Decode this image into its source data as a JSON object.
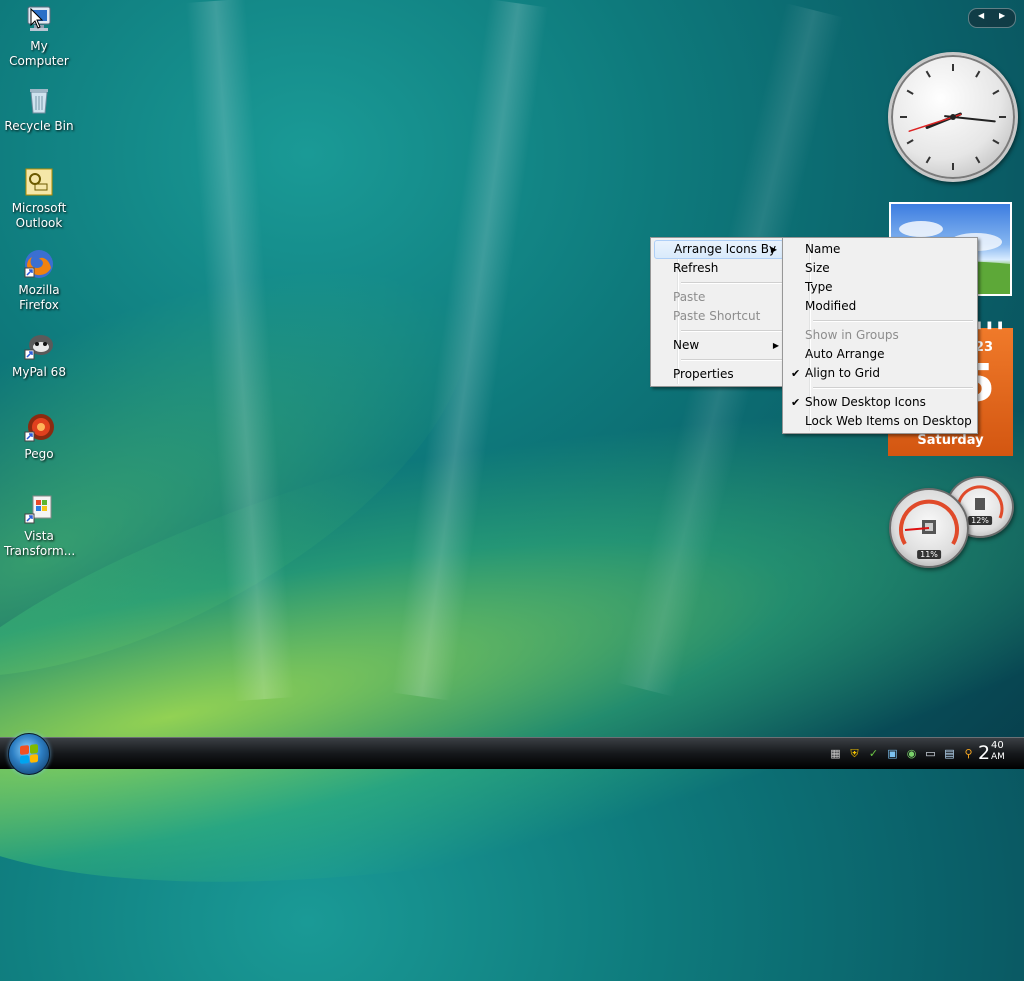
{
  "desktop": {
    "icons": [
      {
        "label": "My Computer",
        "icon": "computer-icon"
      },
      {
        "label": "Recycle Bin",
        "icon": "recycle-bin-icon"
      },
      {
        "label": "Microsoft Outlook",
        "icon": "outlook-icon"
      },
      {
        "label": "Mozilla Firefox",
        "icon": "firefox-icon"
      },
      {
        "label": "MyPal 68",
        "icon": "mypal-icon"
      },
      {
        "label": "Pego",
        "icon": "pego-icon"
      },
      {
        "label": "Vista Transform...",
        "icon": "vista-transform-icon"
      }
    ]
  },
  "context_menu": {
    "items": {
      "arrange": "Arrange Icons By",
      "refresh": "Refresh",
      "paste": "Paste",
      "paste_shortcut": "Paste Shortcut",
      "new": "New",
      "properties": "Properties"
    }
  },
  "submenu": {
    "items": {
      "name": "Name",
      "size": "Size",
      "type": "Type",
      "modified": "Modified",
      "show_in_groups": "Show in Groups",
      "auto_arrange": "Auto Arrange",
      "align_to_grid": "Align to Grid",
      "show_desktop_icons": "Show Desktop Icons",
      "lock_web_items": "Lock Web Items on Desktop"
    },
    "checked": [
      "Align to Grid",
      "Show Desktop Icons"
    ]
  },
  "gadgets": {
    "calendar": {
      "month": "23",
      "day": "5",
      "weekday": "Saturday"
    },
    "cpu_meter": {
      "cpu": "11%",
      "memory": "12%"
    },
    "clock": {
      "hour": 8,
      "minute": 16,
      "second": 42
    }
  },
  "taskbar": {
    "time_hour": "2",
    "time_minute": "40",
    "time_ampm": "AM"
  },
  "colors": {
    "desktop": "#0e7a7c",
    "calendar": "#e8691f",
    "menu_highlight": "#d9eafb"
  }
}
